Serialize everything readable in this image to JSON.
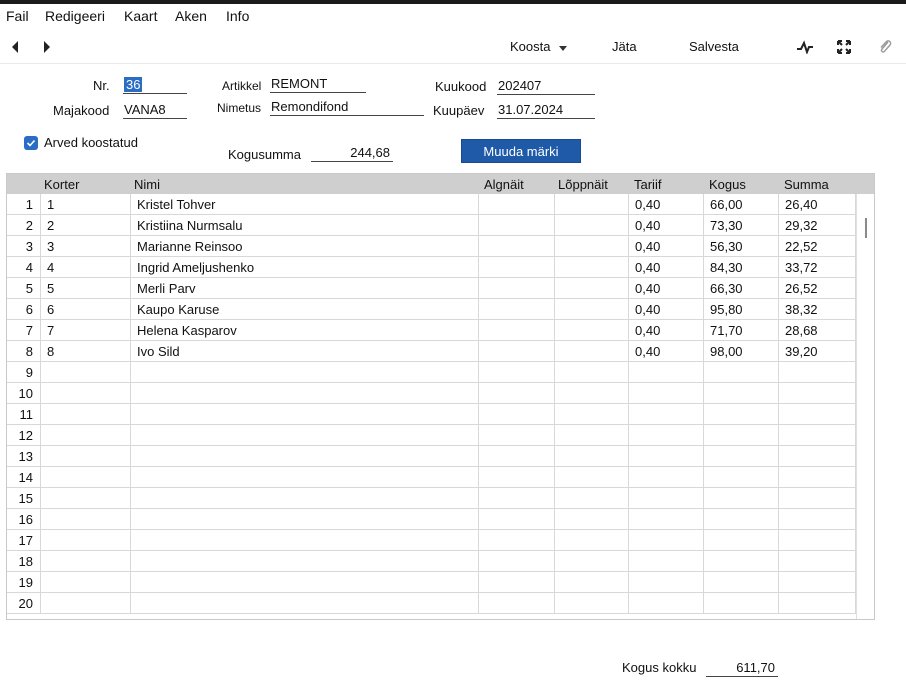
{
  "menu": [
    "Fail",
    "Redigeeri",
    "Kaart",
    "Aken",
    "Info"
  ],
  "toolbar": {
    "koosta_label": "Koosta",
    "jata_label": "Jäta",
    "salvesta_label": "Salvesta"
  },
  "form": {
    "nr_label": "Nr.",
    "nr_value": "36",
    "majakood_label": "Majakood",
    "majakood_value": "VANA8",
    "artikkel_label": "Artikkel",
    "artikkel_value": "REMONT",
    "nimetus_label": "Nimetus",
    "nimetus_value": "Remondifond",
    "kuukood_label": "Kuukood",
    "kuukood_value": "202407",
    "kuupaev_label": "Kuupäev",
    "kuupaev_value": "31.07.2024",
    "arved_label": "Arved koostatud",
    "arved_checked": true,
    "kogusumma_label": "Kogusumma",
    "kogusumma_value": "244,68",
    "muuda_label": "Muuda märki"
  },
  "table": {
    "columns": [
      "Korter",
      "Nimi",
      "Algnäit",
      "Lõppnäit",
      "Tariif",
      "Kogus",
      "Summa"
    ],
    "rows": [
      [
        "1",
        "1",
        "Kristel Tohver",
        "",
        "",
        "0,40",
        "66,00",
        "26,40"
      ],
      [
        "2",
        "2",
        "Kristiina Nurmsalu",
        "",
        "",
        "0,40",
        "73,30",
        "29,32"
      ],
      [
        "3",
        "3",
        "Marianne Reinsoo",
        "",
        "",
        "0,40",
        "56,30",
        "22,52"
      ],
      [
        "4",
        "4",
        "Ingrid Ameljushenko",
        "",
        "",
        "0,40",
        "84,30",
        "33,72"
      ],
      [
        "5",
        "5",
        "Merli Parv",
        "",
        "",
        "0,40",
        "66,30",
        "26,52"
      ],
      [
        "6",
        "6",
        "Kaupo Karuse",
        "",
        "",
        "0,40",
        "95,80",
        "38,32"
      ],
      [
        "7",
        "7",
        "Helena Kasparov",
        "",
        "",
        "0,40",
        "71,70",
        "28,68"
      ],
      [
        "8",
        "8",
        "Ivo Sild",
        "",
        "",
        "0,40",
        "98,00",
        "39,20"
      ],
      [
        "9",
        "",
        "",
        "",
        "",
        "",
        "",
        ""
      ],
      [
        "10",
        "",
        "",
        "",
        "",
        "",
        "",
        ""
      ],
      [
        "11",
        "",
        "",
        "",
        "",
        "",
        "",
        ""
      ],
      [
        "12",
        "",
        "",
        "",
        "",
        "",
        "",
        ""
      ],
      [
        "13",
        "",
        "",
        "",
        "",
        "",
        "",
        ""
      ],
      [
        "14",
        "",
        "",
        "",
        "",
        "",
        "",
        ""
      ],
      [
        "15",
        "",
        "",
        "",
        "",
        "",
        "",
        ""
      ],
      [
        "16",
        "",
        "",
        "",
        "",
        "",
        "",
        ""
      ],
      [
        "17",
        "",
        "",
        "",
        "",
        "",
        "",
        ""
      ],
      [
        "18",
        "",
        "",
        "",
        "",
        "",
        "",
        ""
      ],
      [
        "19",
        "",
        "",
        "",
        "",
        "",
        "",
        ""
      ],
      [
        "20",
        "",
        "",
        "",
        "",
        "",
        "",
        ""
      ]
    ]
  },
  "footer": {
    "kogus_kokku_label": "Kogus kokku",
    "kogus_kokku_value": "611,70"
  },
  "icons": {
    "back": "chevron-left-icon",
    "forward": "chevron-right-icon",
    "dropdown": "caret-down-icon",
    "activity": "activity-icon",
    "expand": "expand-icon",
    "attach": "paperclip-icon"
  },
  "colors": {
    "accent": "#2b6cc4",
    "button": "#1e5aa8",
    "header_bg": "#cfcfcf"
  }
}
